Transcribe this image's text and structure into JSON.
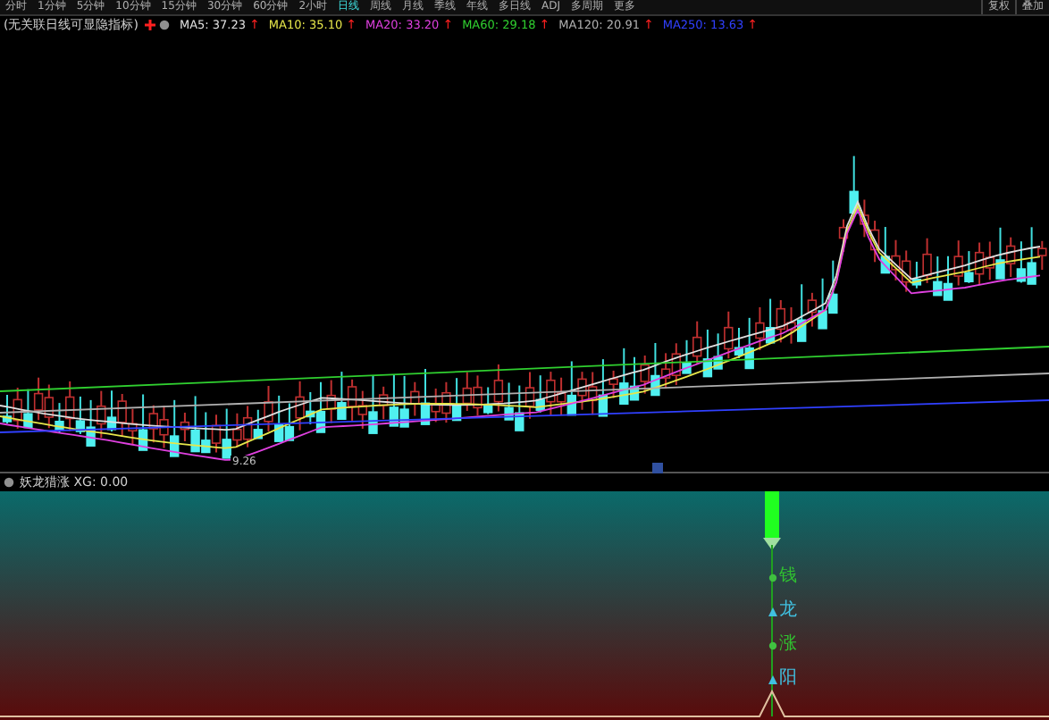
{
  "toolbar": {
    "periods": [
      {
        "label": "分时",
        "selected": false
      },
      {
        "label": "1分钟",
        "selected": false
      },
      {
        "label": "5分钟",
        "selected": false
      },
      {
        "label": "10分钟",
        "selected": false
      },
      {
        "label": "15分钟",
        "selected": false
      },
      {
        "label": "30分钟",
        "selected": false
      },
      {
        "label": "60分钟",
        "selected": false
      },
      {
        "label": "2小时",
        "selected": false
      },
      {
        "label": "日线",
        "selected": true
      },
      {
        "label": "周线",
        "selected": false
      },
      {
        "label": "月线",
        "selected": false
      },
      {
        "label": "季线",
        "selected": false
      },
      {
        "label": "年线",
        "selected": false
      },
      {
        "label": "多日线",
        "selected": false
      },
      {
        "label": "ADJ",
        "selected": false
      },
      {
        "label": "多周期",
        "selected": false
      },
      {
        "label": "更多",
        "selected": false
      }
    ],
    "right_buttons": [
      "复权",
      "叠加"
    ]
  },
  "indicator_bar": {
    "title": "(无关联日线可显隐指标)",
    "averages": [
      {
        "label": "MA5: 37.23",
        "arrow": "↑",
        "color": "#e0e0e0"
      },
      {
        "label": "MA10: 35.10",
        "arrow": "↑",
        "color": "#e6e64a"
      },
      {
        "label": "MA20: 33.20",
        "arrow": "↑",
        "color": "#e040e0"
      },
      {
        "label": "MA60: 29.18",
        "arrow": "↑",
        "color": "#30d030"
      },
      {
        "label": "MA120: 20.91",
        "arrow": "↑",
        "color": "#b0b0b0"
      },
      {
        "label": "MA250: 13.63",
        "arrow": "↑",
        "color": "#3040ff"
      }
    ]
  },
  "price_chart": {
    "low_label": "9.26"
  },
  "sub_panel": {
    "title": "妖龙猎涨 XG: 0.00",
    "signal_labels": [
      {
        "label": "钱",
        "kind": "circle"
      },
      {
        "label": "龙",
        "kind": "triangle"
      },
      {
        "label": "涨",
        "kind": "circle"
      },
      {
        "label": "阳",
        "kind": "triangle"
      }
    ]
  }
}
